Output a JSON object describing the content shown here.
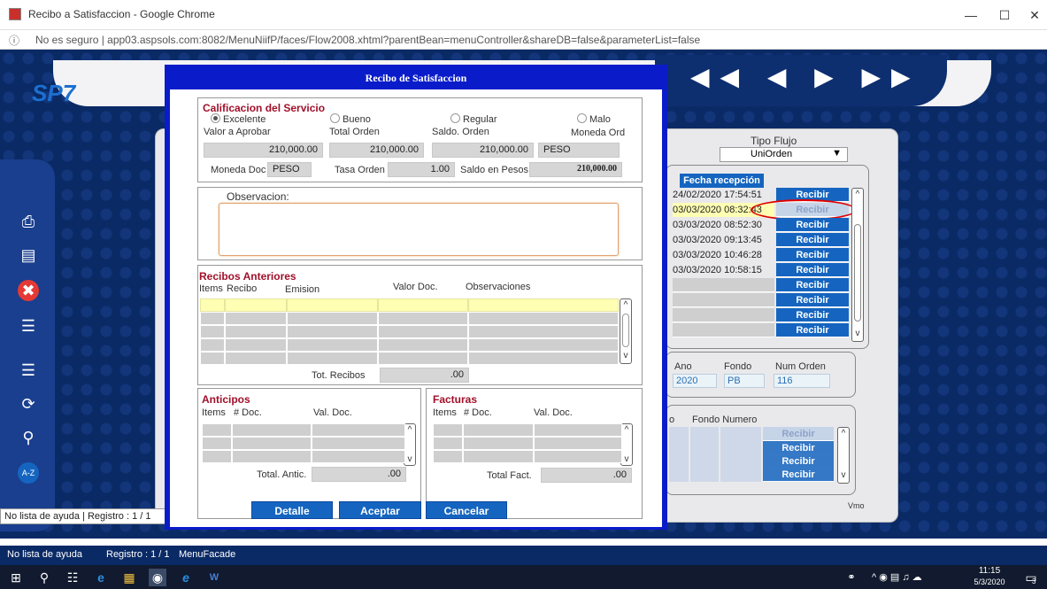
{
  "window": {
    "title": "Recibo a Satisfaccion - Google Chrome",
    "url": "No es seguro  |  app03.aspsols.com:8082/MenuNiifP/faces/Flow2008.xhtml?parentBean=menuController&shareDB=false&parameterList=false"
  },
  "app": {
    "logo_left": "SP",
    "logo_right": "7",
    "nav_arrows": "◀◀ ◀ ▶ ▶▶"
  },
  "background": {
    "tipo_flujo_label": "Tipo Flujo",
    "tipo_flujo_value": "UniOrden",
    "fecha_header": "Fecha recepción",
    "rows": [
      {
        "fecha": "24/02/2020 17:54:51",
        "btn": "Recibir",
        "enabled": true,
        "highlight": false
      },
      {
        "fecha": "03/03/2020 08:32:43",
        "btn": "Recibir",
        "enabled": false,
        "highlight": true
      },
      {
        "fecha": "03/03/2020 08:52:30",
        "btn": "Recibir",
        "enabled": true,
        "highlight": false
      },
      {
        "fecha": "03/03/2020 09:13:45",
        "btn": "Recibir",
        "enabled": true,
        "highlight": false
      },
      {
        "fecha": "03/03/2020 10:46:28",
        "btn": "Recibir",
        "enabled": true,
        "highlight": false
      },
      {
        "fecha": "03/03/2020 10:58:15",
        "btn": "Recibir",
        "enabled": true,
        "highlight": false
      },
      {
        "fecha": "",
        "btn": "Recibir",
        "enabled": true,
        "highlight": false
      },
      {
        "fecha": "",
        "btn": "Recibir",
        "enabled": true,
        "highlight": false
      },
      {
        "fecha": "",
        "btn": "Recibir",
        "enabled": true,
        "highlight": false
      },
      {
        "fecha": "",
        "btn": "Recibir",
        "enabled": true,
        "highlight": false
      }
    ],
    "ano_label": "Ano",
    "ano_value": "2020",
    "fondo_label": "Fondo",
    "fondo_value": "PB",
    "num_orden_label": "Num Orden",
    "num_orden_value": "116",
    "fondo_numero_label": "Fondo Numero",
    "fondo_prefix": "o",
    "lower_buttons": [
      "Recibir",
      "Recibir",
      "Recibir",
      "Recibir"
    ],
    "vmo": "Vmo",
    "status_left": "No lista de ayuda  |  Registro : 1 / 1"
  },
  "statusbar": {
    "ayuda": "No lista de ayuda",
    "registro": "Registro : 1 / 1",
    "menu": "MenuFacade"
  },
  "taskbar": {
    "time": "11:15",
    "date": "5/3/2020",
    "notif_count": "3"
  },
  "modal": {
    "title": "Recibo de Satisfaccion",
    "calificacion": {
      "legend": "Calificacion del Servicio",
      "options": [
        "Excelente",
        "Bueno",
        "Regular",
        "Malo"
      ],
      "selected": "Excelente",
      "valor_aprobar_label": "Valor a Aprobar",
      "valor_aprobar": "210,000.00",
      "total_orden_label": "Total Orden",
      "total_orden": "210,000.00",
      "saldo_orden_label": "Saldo. Orden",
      "saldo_orden": "210,000.00",
      "moneda_ord_label": "Moneda Ord",
      "moneda_ord": "PESO",
      "moneda_doc_label": "Moneda Doc",
      "moneda_doc": "PESO",
      "tasa_orden_label": "Tasa Orden",
      "tasa_orden": "1.00",
      "saldo_pesos_label": "Saldo en Pesos",
      "saldo_pesos": "210,000.00"
    },
    "observacion": {
      "label": "Observacion:",
      "value": ""
    },
    "recibos": {
      "legend": "Recibos Anteriores",
      "col_items": "Items",
      "col_recibo": "Recibo",
      "col_emision": "Emision",
      "col_valor": "Valor Doc.",
      "col_obs": "Observaciones",
      "tot_label": "Tot. Recibos",
      "tot_value": ".00"
    },
    "anticipos": {
      "legend": "Anticipos",
      "col_items": "Items",
      "col_doc": "# Doc.",
      "col_val": "Val. Doc.",
      "total_label": "Total. Antic.",
      "total_value": ".00"
    },
    "facturas": {
      "legend": "Facturas",
      "col_items": "Items",
      "col_doc": "# Doc.",
      "col_val": "Val. Doc.",
      "total_label": "Total Fact.",
      "total_value": ".00"
    },
    "buttons": {
      "detalle": "Detalle",
      "aceptar": "Aceptar",
      "cancelar": "Cancelar"
    }
  }
}
